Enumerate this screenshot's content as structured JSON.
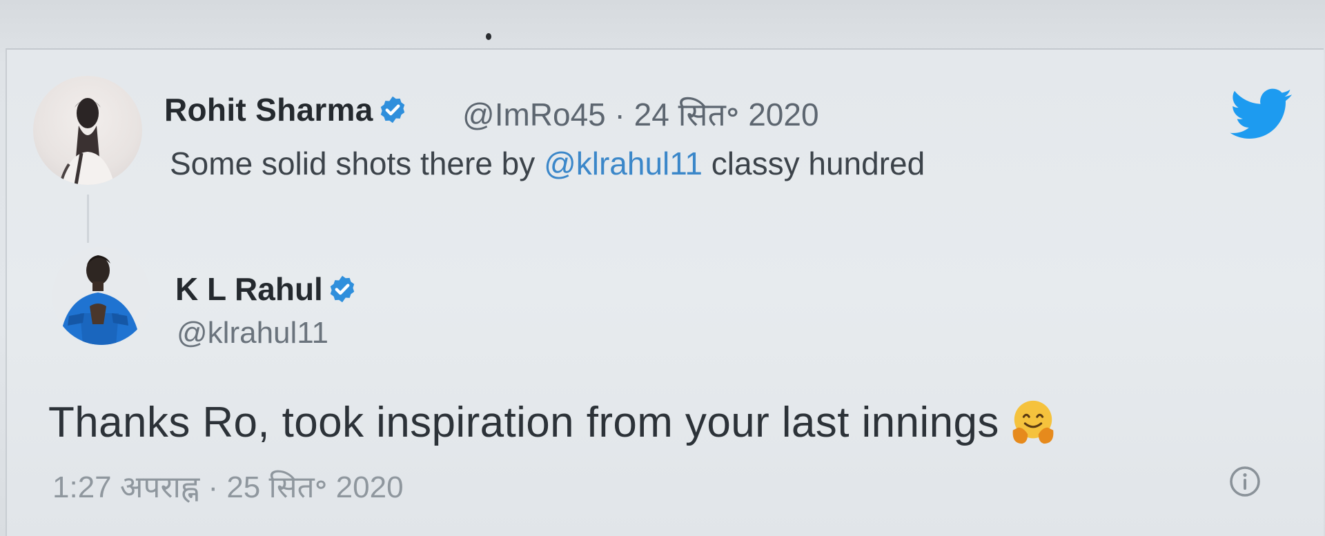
{
  "quoted_tweet": {
    "author_name": "Rohit Sharma",
    "verified": true,
    "handle": "@ImRo45",
    "separator": "·",
    "date": "24 सित॰ 2020",
    "text_before": "Some solid shots there by ",
    "mention": "@klrahul11",
    "text_after": " classy hundred"
  },
  "reply_tweet": {
    "author_name": "K L Rahul",
    "verified": true,
    "handle": "@klrahul11",
    "text": "Thanks Ro, took inspiration from your last innings",
    "emoji": "hugging-face",
    "timestamp": "1:27 अपराह्न · 25 सित॰ 2020"
  },
  "icons": {
    "brand": "twitter-bird-icon",
    "info": "info-icon",
    "verified": "verified-badge-icon"
  },
  "colors": {
    "twitter_blue": "#1d9bf0",
    "mention": "#3b87c9",
    "primary_text": "#2c3238",
    "secondary_text": "#8f979e"
  }
}
